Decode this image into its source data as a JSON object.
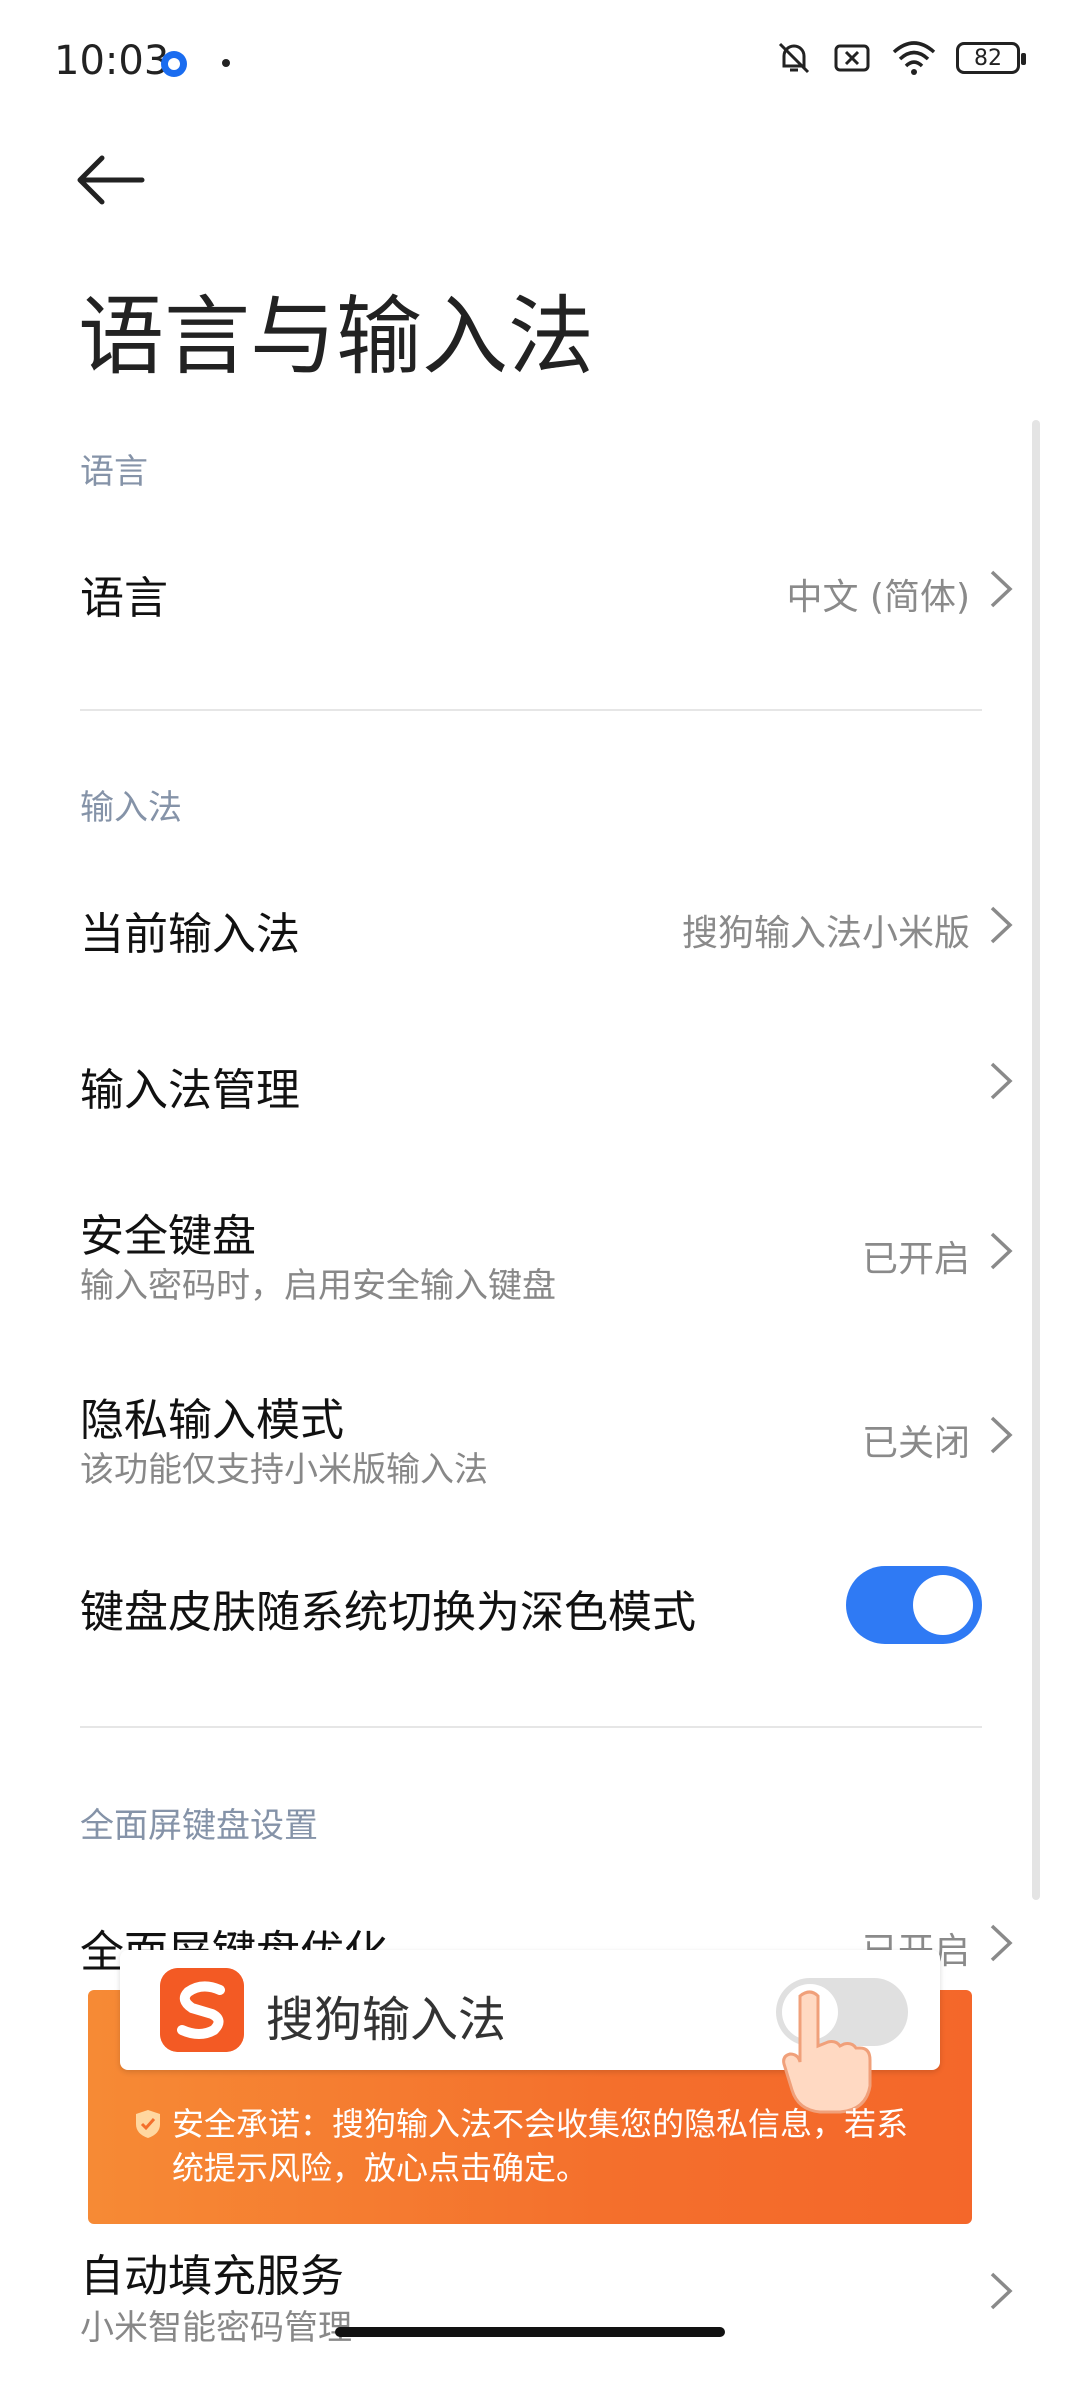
{
  "status": {
    "time": "10:03",
    "battery": "82"
  },
  "header": {
    "title": "语言与输入法"
  },
  "sections": {
    "language": {
      "header": "语言",
      "rows": [
        {
          "title": "语言",
          "value": "中文 (简体)"
        }
      ]
    },
    "input_method": {
      "header": "输入法",
      "rows": [
        {
          "title": "当前输入法",
          "value": "搜狗输入法小米版"
        },
        {
          "title": "输入法管理"
        },
        {
          "title": "安全键盘",
          "subtitle": "输入密码时，启用安全输入键盘",
          "value": "已开启"
        },
        {
          "title": "隐私输入模式",
          "subtitle": "该功能仅支持小米版输入法",
          "value": "已关闭"
        },
        {
          "title": "键盘皮肤随系统切换为深色模式",
          "toggle": true
        }
      ]
    },
    "fullscreen": {
      "header": "全面屏键盘设置",
      "rows": [
        {
          "title": "全面屏键盘优化",
          "value": "已开启"
        }
      ]
    },
    "autofill": {
      "rows": [
        {
          "title": "自动填充服务",
          "subtitle": "小米智能密码管理"
        }
      ]
    }
  },
  "overlay": {
    "app_name": "搜狗输入法",
    "note": "安全承诺：搜狗输入法不会收集您的隐私信息，若系统提示风险，放心点击确定。",
    "toggle": false
  },
  "colors": {
    "accent": "#2f7af4",
    "overlay": "#f46f2c",
    "section_header": "#8593a8"
  }
}
